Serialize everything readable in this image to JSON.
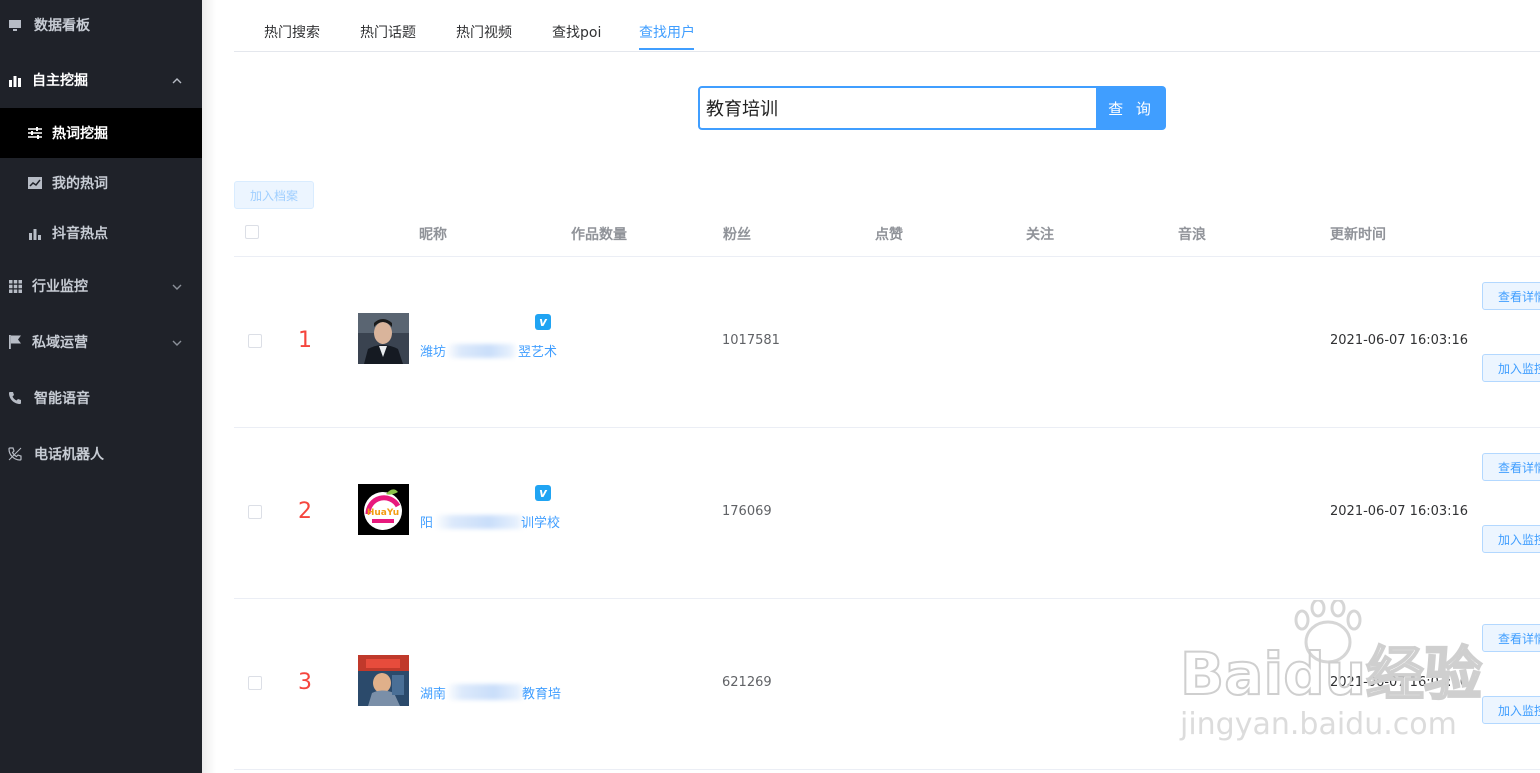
{
  "sidebar": {
    "items": [
      {
        "label": "数据看板",
        "icon": "monitor-icon"
      },
      {
        "label": "自主挖掘",
        "icon": "bar-chart-icon"
      },
      {
        "label": "热词挖掘",
        "icon": "sliders-icon"
      },
      {
        "label": "我的热词",
        "icon": "line-chart-icon"
      },
      {
        "label": "抖音热点",
        "icon": "bar-chart-icon"
      },
      {
        "label": "行业监控",
        "icon": "grid-icon"
      },
      {
        "label": "私域运营",
        "icon": "flag-icon"
      },
      {
        "label": "智能语音",
        "icon": "phone-icon"
      },
      {
        "label": "电话机器人",
        "icon": "phone-robot-icon"
      }
    ]
  },
  "tabs": [
    "热门搜索",
    "热门话题",
    "热门视频",
    "查找poi",
    "查找用户"
  ],
  "active_tab": "查找用户",
  "search": {
    "value": "教育培训",
    "button": "查 询"
  },
  "toolbar": {
    "add_archive": "加入档案"
  },
  "table": {
    "headers": {
      "nickname": "昵称",
      "works": "作品数量",
      "fans": "粉丝",
      "likes": "点赞",
      "follows": "关注",
      "sound": "音浪",
      "updated": "更新时间"
    },
    "rows": [
      {
        "rank": "1",
        "nick_start": "潍坊",
        "nick_end": "翌艺术",
        "verified": true,
        "fans": "1017581",
        "updated": "2021-06-07 16:03:16",
        "btn_detail": "查看详情",
        "btn_monitor": "加入监控"
      },
      {
        "rank": "2",
        "nick_start": "阳",
        "nick_end": "训学校",
        "verified": true,
        "fans": "176069",
        "updated": "2021-06-07 16:03:16",
        "btn_detail": "查看详情",
        "btn_monitor": "加入监控"
      },
      {
        "rank": "3",
        "nick_start": "湖南",
        "nick_end": "教育培",
        "verified": false,
        "fans": "621269",
        "updated": "2021-06-07 16:03:16",
        "btn_detail": "查看详情",
        "btn_monitor": "加入监控"
      }
    ]
  },
  "watermark": {
    "line1": "Baidu经验",
    "line2": "jingyan.baidu.com"
  },
  "avatar_logo_text": "HuaYu"
}
